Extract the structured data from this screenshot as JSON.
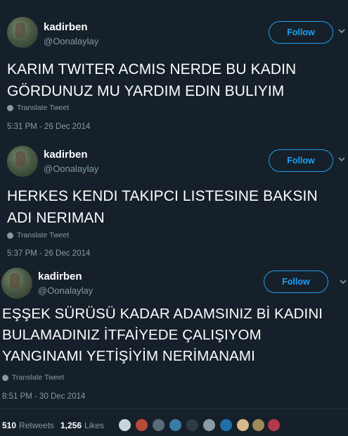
{
  "tweets": [
    {
      "name": "kadirben",
      "handle": "@Oonalaylay",
      "follow_label": "Follow",
      "text_lines": [
        "KARIM TWITER ACMIS NERDE BU KADIN",
        "GÖRDUNUZ MU YARDIM EDIN BULIYIM"
      ],
      "translate_label": "Translate Tweet",
      "timestamp": "5:31 PM - 26 Dec 2014"
    },
    {
      "name": "kadirben",
      "handle": "@Oonalaylay",
      "follow_label": "Follow",
      "text_lines": [
        "HERKES KENDI TAKIPCI LISTESINE BAKSIN",
        "ADI NERIMAN"
      ],
      "translate_label": "Translate Tweet",
      "timestamp": "5:37 PM - 26 Dec 2014"
    },
    {
      "name": "kadirben",
      "handle": "@Oonalaylay",
      "follow_label": "Follow",
      "text_lines": [
        "EŞŞEK SÜRÜSÜ KADAR ADAMSINIZ Bİ KADINI",
        "BULAMADINIZ İTFAİYEDE ÇALIŞIYOM",
        "YANGINAMI YETİŞİYİM NERİMANAMI"
      ],
      "translate_label": "Translate Tweet",
      "timestamp": "8:51 PM - 30 Dec 2014"
    }
  ],
  "stats": {
    "retweets_count": "510",
    "retweets_label": "Retweets",
    "likes_count": "1,256",
    "likes_label": "Likes"
  },
  "colors": {
    "background": "#15202b",
    "accent": "#1da1f2",
    "secondary_text": "#8899a6"
  }
}
